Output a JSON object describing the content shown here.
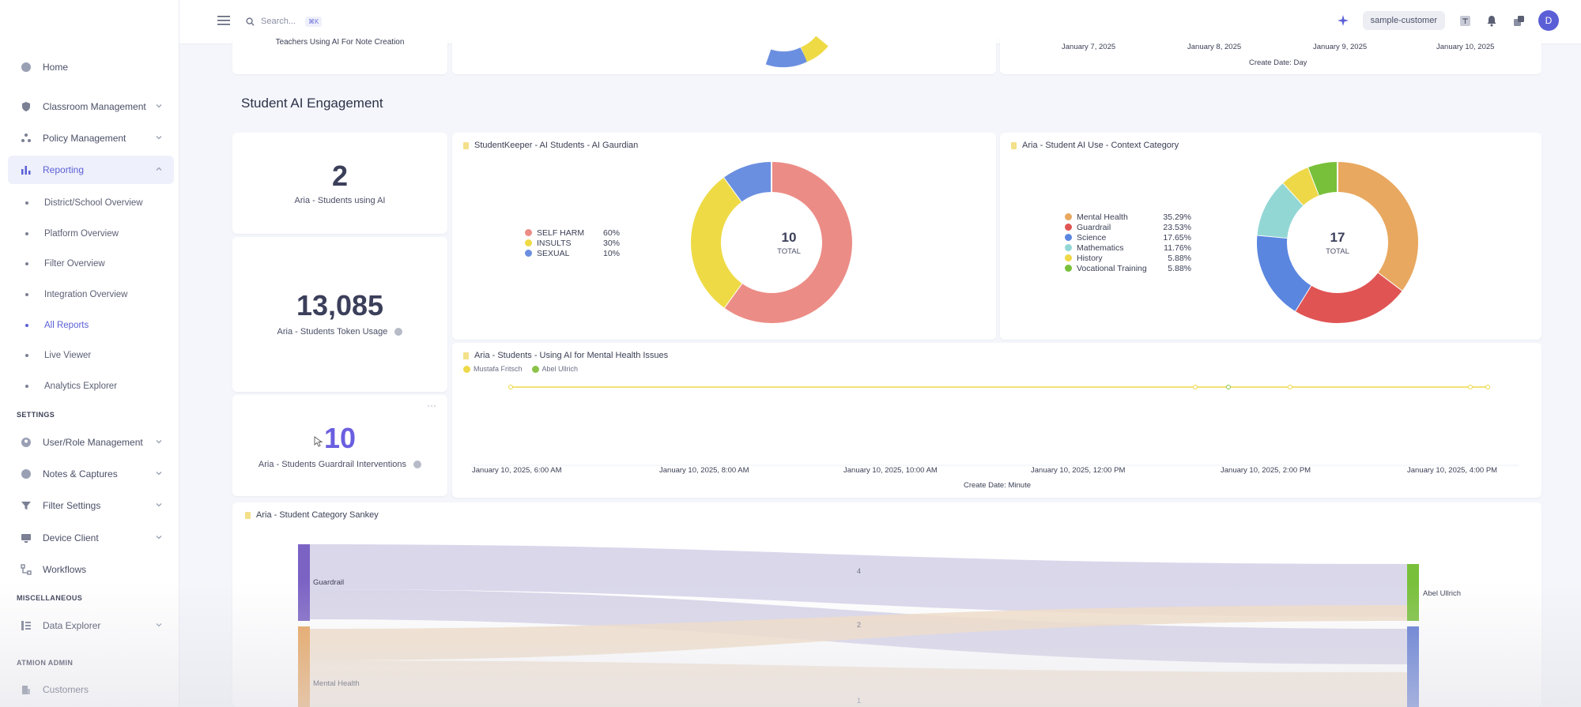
{
  "sidebar": {
    "items": [
      {
        "label": "Home",
        "icon": "home-icon"
      },
      {
        "label": "Classroom Management",
        "icon": "shield-icon"
      },
      {
        "label": "Policy Management",
        "icon": "policy-icon"
      },
      {
        "label": "Reporting",
        "icon": "chart-icon"
      }
    ],
    "reporting_sub": [
      {
        "label": "District/School Overview"
      },
      {
        "label": "Platform Overview"
      },
      {
        "label": "Filter Overview"
      },
      {
        "label": "Integration Overview"
      },
      {
        "label": "All Reports"
      },
      {
        "label": "Live Viewer"
      },
      {
        "label": "Analytics Explorer"
      }
    ],
    "settings_label": "SETTINGS",
    "settings_items": [
      {
        "label": "User/Role Management"
      },
      {
        "label": "Notes & Captures"
      },
      {
        "label": "Filter Settings"
      },
      {
        "label": "Device Client"
      },
      {
        "label": "Workflows"
      }
    ],
    "misc_label": "MISCELLANEOUS",
    "misc_items": [
      {
        "label": "Data Explorer"
      }
    ],
    "admin_label": "ATMION ADMIN",
    "admin_items": [
      {
        "label": "Customers"
      }
    ]
  },
  "topbar": {
    "search_placeholder": "Search...",
    "shortcut": "⌘K",
    "customer": "sample-customer",
    "avatar_initial": "D"
  },
  "top_partial": {
    "left_label": "Teachers Using AI For Note Creation",
    "dates": [
      "January 7, 2025",
      "January 8, 2025",
      "January 9, 2025",
      "January 10, 2025"
    ],
    "axis_title": "Create Date: Day"
  },
  "section": {
    "title": "Student AI Engagement"
  },
  "kpis": [
    {
      "value": "2",
      "label": "Aria - Students using AI"
    },
    {
      "value": "13,085",
      "label": "Aria - Students Token Usage"
    },
    {
      "value": "10",
      "label": "Aria - Students Guardrail Interventions"
    }
  ],
  "donut1": {
    "title": "StudentKeeper - AI Students - AI Gaurdian",
    "total": "10",
    "total_label": "TOTAL",
    "chart_data": {
      "type": "pie",
      "labels": [
        "SELF HARM",
        "INSULTS",
        "SEXUAL"
      ],
      "pct_labels": [
        "60%",
        "30%",
        "10%"
      ],
      "values": [
        60,
        30,
        10
      ],
      "colors": [
        "#ec8c86",
        "#eeda45",
        "#6b8fe0"
      ]
    }
  },
  "donut2": {
    "title": "Aria - Student AI Use - Context Category",
    "total": "17",
    "total_label": "TOTAL",
    "chart_data": {
      "type": "pie",
      "labels": [
        "Mental Health",
        "Guardrail",
        "Science",
        "Mathematics",
        "History",
        "Vocational Training"
      ],
      "pct_labels": [
        "35.29%",
        "23.53%",
        "17.65%",
        "11.76%",
        "5.88%",
        "5.88%"
      ],
      "values": [
        35.29,
        23.53,
        17.65,
        11.76,
        5.88,
        5.88
      ],
      "colors": [
        "#e8a860",
        "#e05454",
        "#5b86e0",
        "#93d7d5",
        "#eed848",
        "#78c03a"
      ]
    }
  },
  "line_chart": {
    "title": "Aria - Students - Using AI for Mental Health Issues",
    "legend": [
      {
        "name": "Mustafa Fritsch",
        "color": "#eed848"
      },
      {
        "name": "Abel Ullrich",
        "color": "#8bc34a"
      }
    ],
    "x_labels": [
      "January 10, 2025, 6:00 AM",
      "January 10, 2025, 8:00 AM",
      "January 10, 2025, 10:00 AM",
      "January 10, 2025, 12:00 PM",
      "January 10, 2025, 2:00 PM",
      "January 10, 2025, 4:00 PM"
    ],
    "axis_title": "Create Date: Minute"
  },
  "sankey": {
    "title": "Aria - Student Category Sankey",
    "left_nodes": [
      "Guardrail",
      "Mental Health"
    ],
    "right_nodes": [
      "Abel Ullrich"
    ],
    "flow_labels": [
      "4",
      "2",
      "1"
    ]
  }
}
